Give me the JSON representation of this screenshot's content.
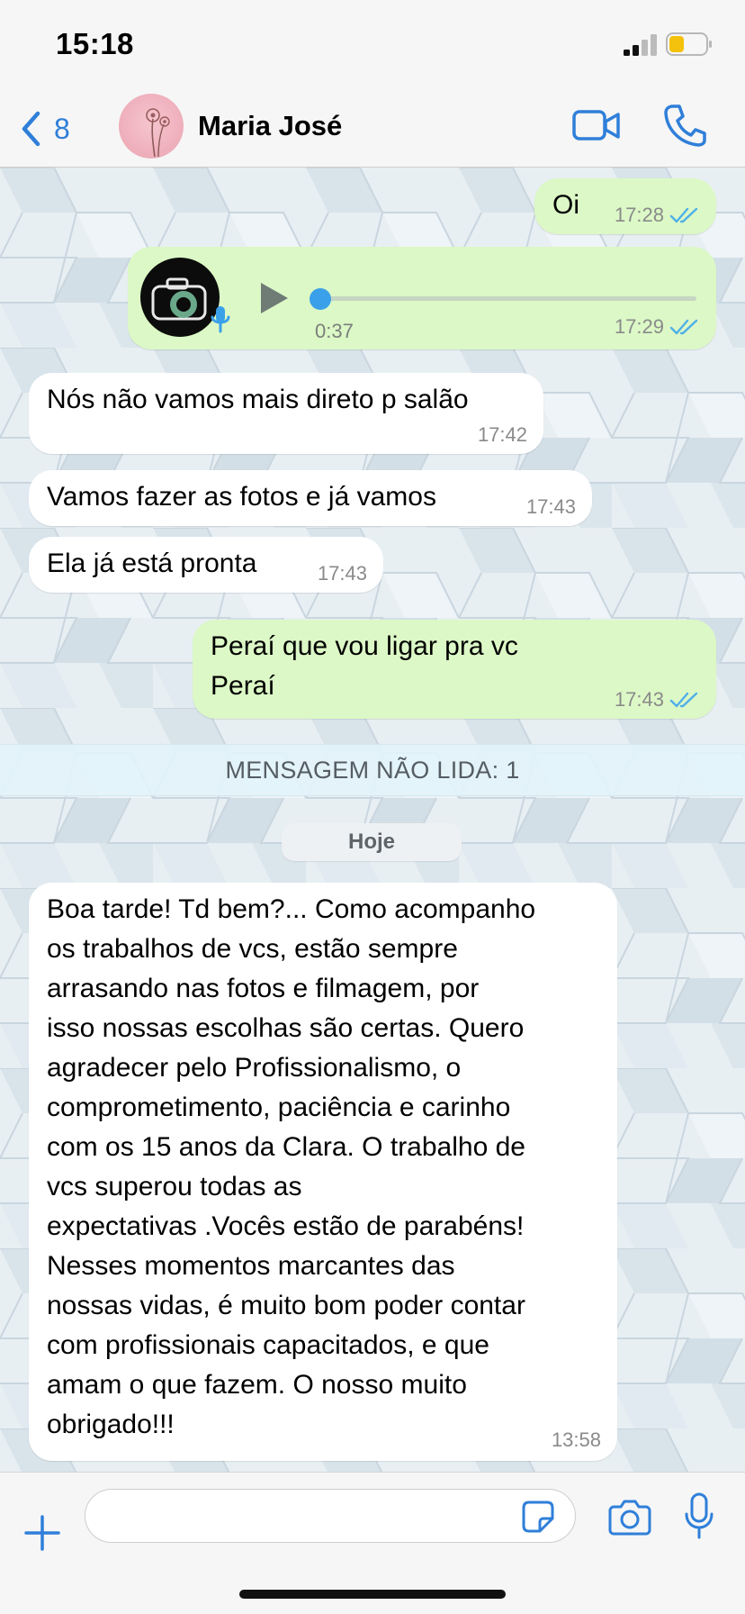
{
  "status_bar": {
    "time": "15:18"
  },
  "header": {
    "back_count": "8",
    "contact_name": "Maria José"
  },
  "messages": [
    {
      "text": "Oi",
      "time": "17:28",
      "direction": "out"
    },
    {
      "type": "voice",
      "duration": "0:37",
      "time": "17:29",
      "direction": "out"
    },
    {
      "text": "Nós não vamos mais direto p salão",
      "time": "17:42",
      "direction": "in"
    },
    {
      "text": "Vamos fazer as fotos e já vamos",
      "time": "17:43",
      "direction": "in"
    },
    {
      "text": "Ela já está pronta",
      "time": "17:43",
      "direction": "in"
    },
    {
      "line1": "Peraí que vou ligar pra vc",
      "line2": "Peraí",
      "time": "17:43",
      "direction": "out"
    },
    {
      "lines": [
        "Boa tarde! Td bem?... Como acompanho",
        "os trabalhos de vcs, estão sempre",
        "arrasando nas fotos e filmagem, por",
        "isso nossas escolhas são certas.  Quero",
        "agradecer pelo Profissionalismo, o",
        "comprometimento, paciência e carinho",
        "com os 15 anos da Clara. O trabalho de",
        "vcs  superou todas as",
        "expectativas .Vocês estão de parabéns!",
        "Nesses momentos marcantes das",
        "nossas vidas, é muito bom poder contar",
        "com profissionais capacitados, e que",
        "amam o que fazem. O nosso muito",
        "obrigado!!!"
      ],
      "time": "13:58",
      "direction": "in"
    }
  ],
  "unread_banner": "MENSAGEM NÃO LIDA: 1",
  "date_separator": "Hoje",
  "composer": {
    "placeholder": ""
  },
  "colors": {
    "accent": "#2f7fd9",
    "outgoing_bubble": "#dcf8c6",
    "incoming_bubble": "#ffffff",
    "read_ticks": "#4fb0e8",
    "voice_progress": "#3aa0ea"
  }
}
